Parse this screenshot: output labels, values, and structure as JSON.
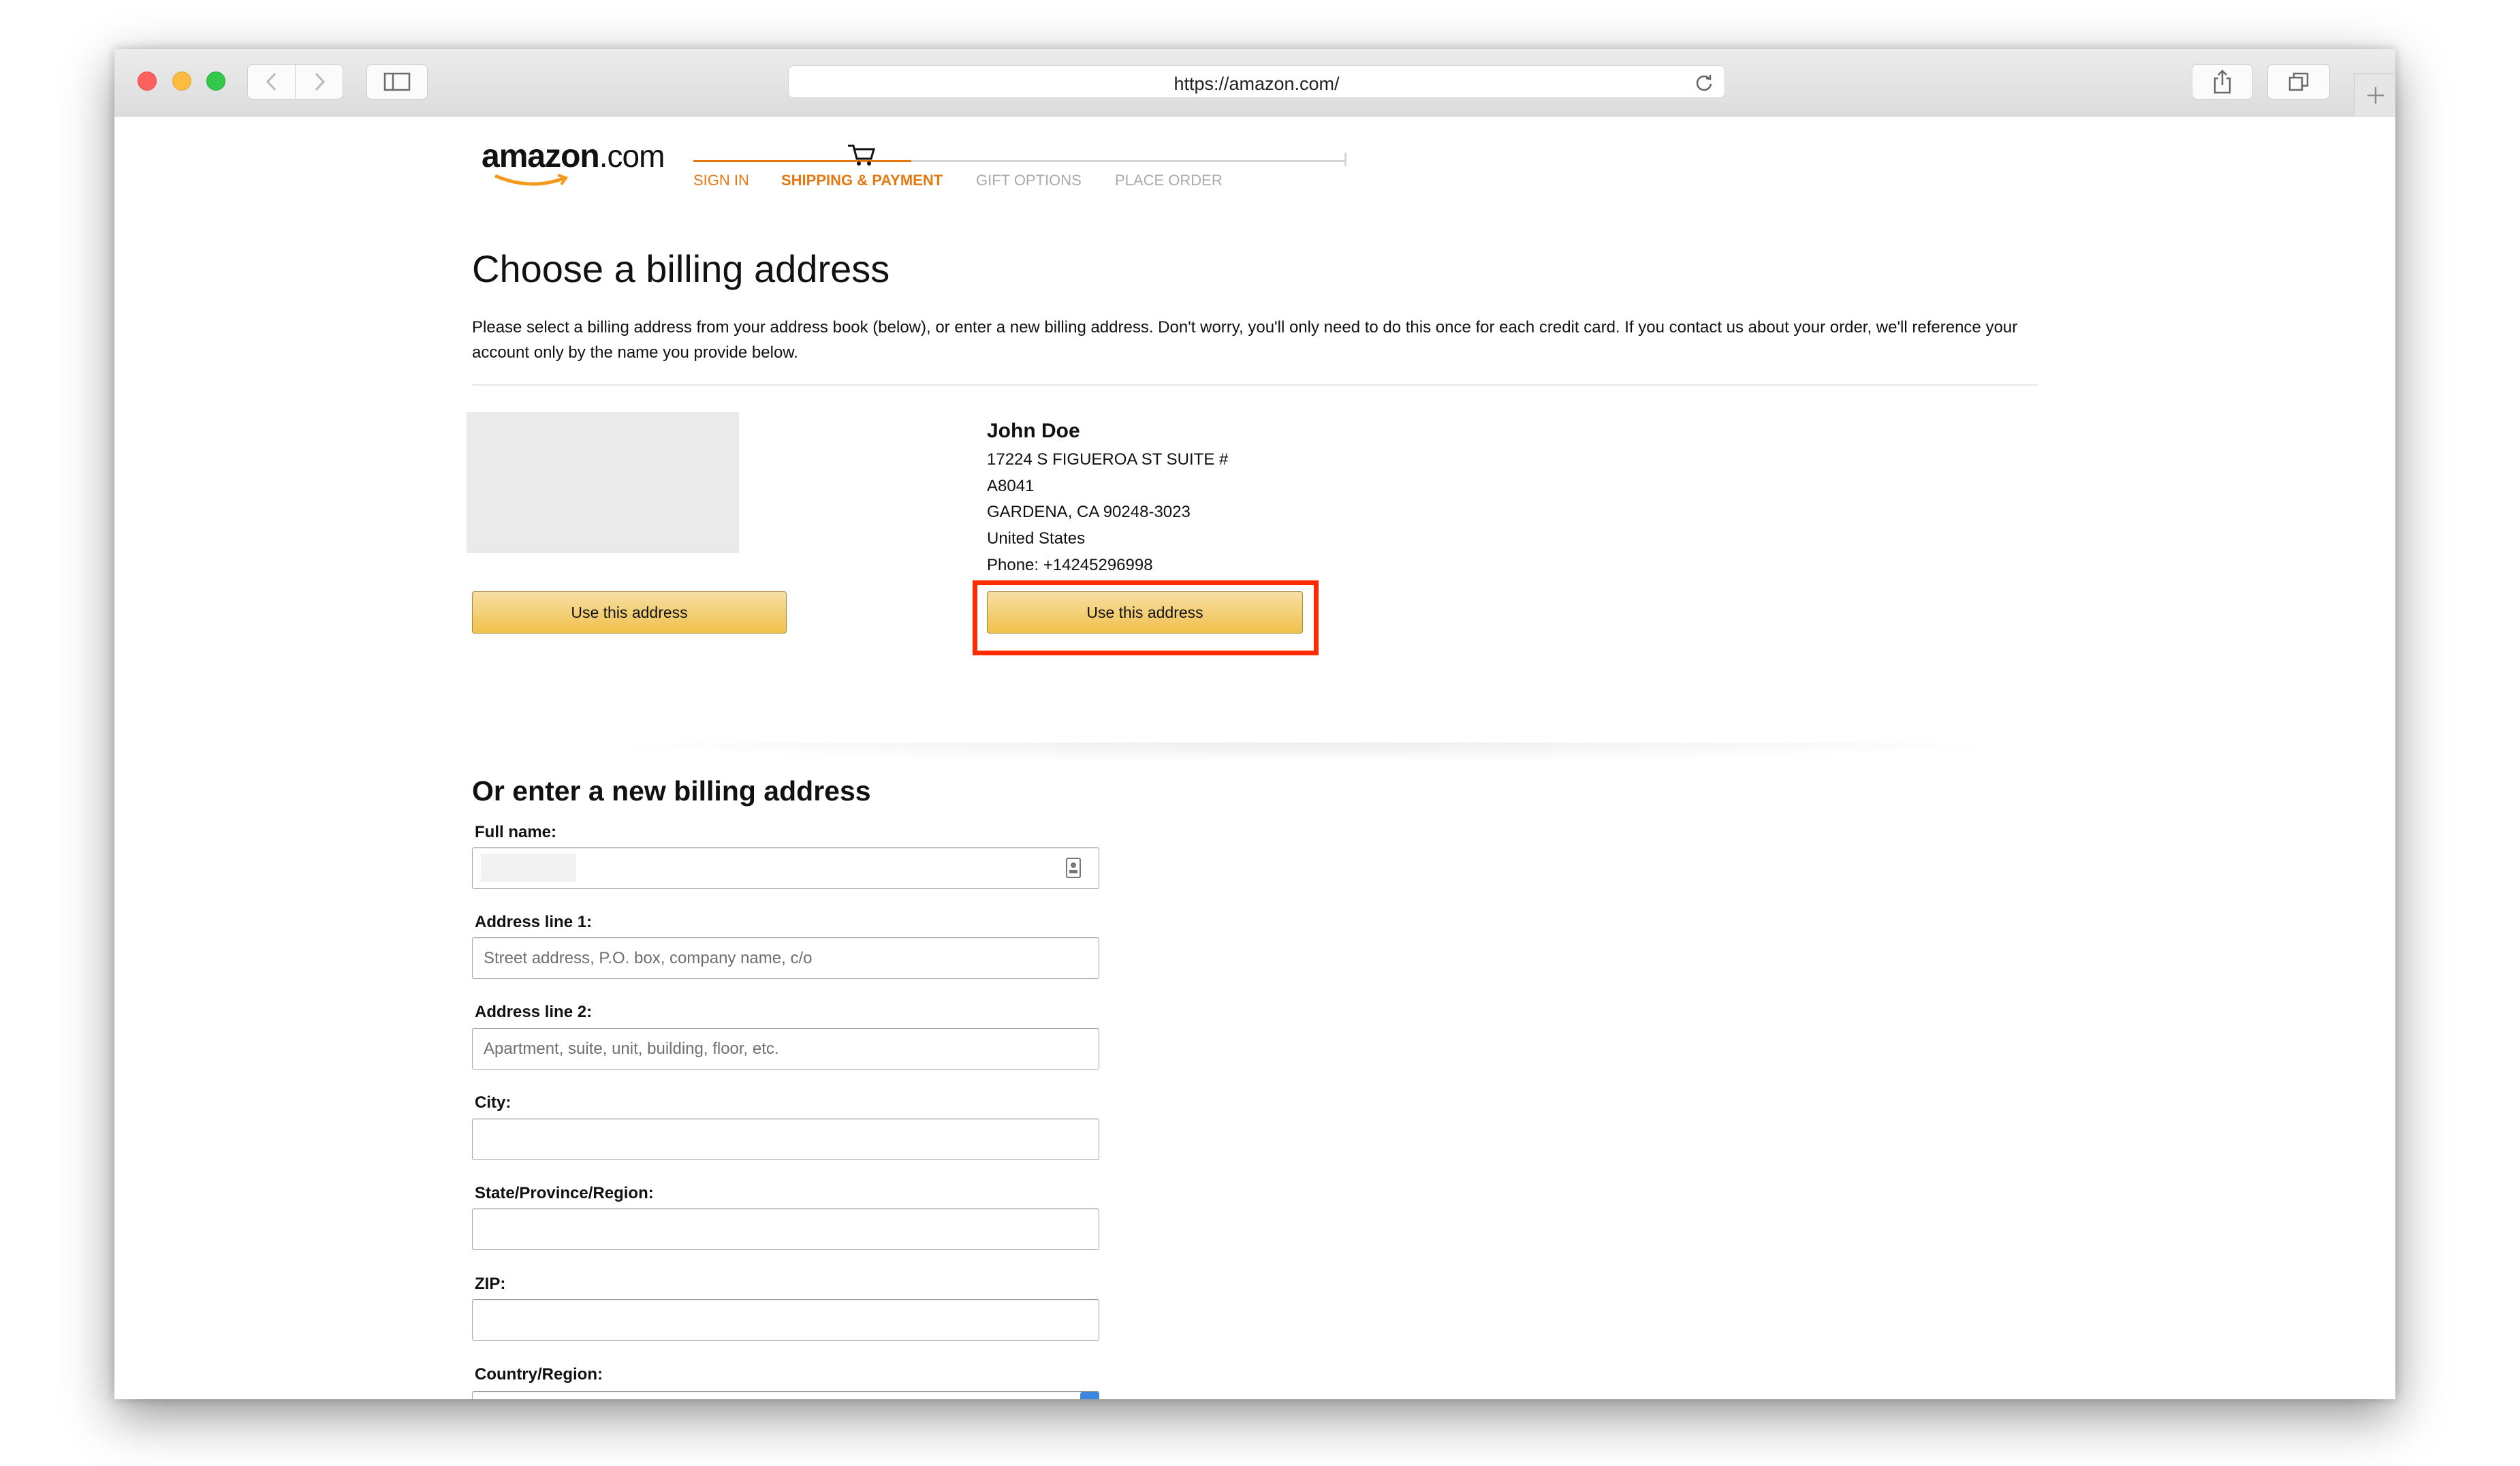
{
  "browser": {
    "url": "https://amazon.com/",
    "traffic_lights": {
      "close": "#fc615d",
      "minimize": "#fdbc40",
      "zoom": "#34c84a"
    }
  },
  "header": {
    "logo_text": "amazon",
    "logo_suffix": ".com",
    "steps": [
      {
        "label": "SIGN IN",
        "state": "done"
      },
      {
        "label": "SHIPPING & PAYMENT",
        "state": "current"
      },
      {
        "label": "GIFT OPTIONS",
        "state": "todo"
      },
      {
        "label": "PLACE ORDER",
        "state": "todo"
      }
    ]
  },
  "billing": {
    "title": "Choose a billing address",
    "description": "Please select a billing address from your address book (below), or enter a new billing address. Don't worry, you'll only need to do this once for each credit card. If you contact us about your order, we'll reference your account only by the name you provide below.",
    "addresses": [
      {
        "name": "John Doe",
        "line1": "17224 S FIGUEROA ST SUITE #",
        "line2": "A8041",
        "city_line": "GARDENA, CA 90248-3023",
        "country": "United States",
        "phone": "Phone: +14245296998"
      }
    ],
    "use_button_label": "Use this address"
  },
  "new_address": {
    "title": "Or enter a new billing address",
    "full_name_label": "Full name:",
    "full_name_value": "",
    "address1_label": "Address line 1:",
    "address1_placeholder": "Street address, P.O. box, company name, c/o",
    "address2_label": "Address line 2:",
    "address2_placeholder": "Apartment, suite, unit, building, floor, etc.",
    "city_label": "City:",
    "state_label": "State/Province/Region:",
    "zip_label": "ZIP:",
    "country_label": "Country/Region:"
  },
  "colors": {
    "amazon_orange": "#e47911",
    "button_gold": "#f0c14b",
    "highlight_red": "#ff2a00"
  }
}
